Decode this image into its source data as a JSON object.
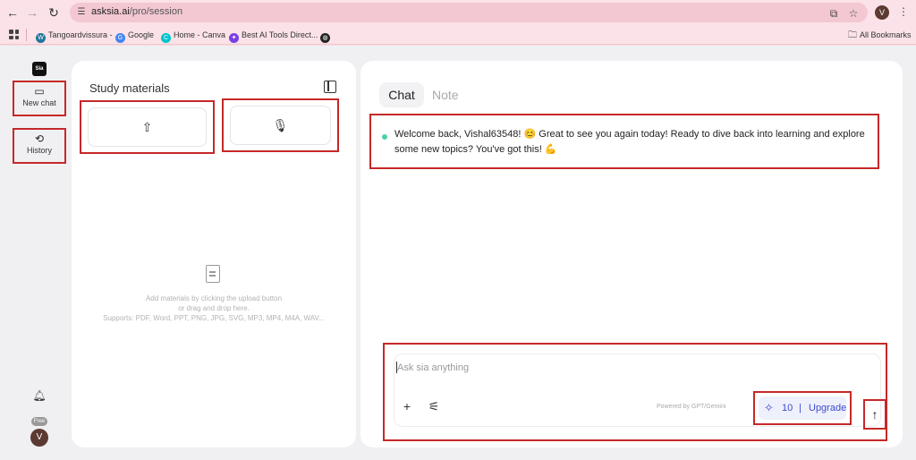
{
  "browser": {
    "url_host": "asksia.ai",
    "url_path": "/pro/session",
    "profile_initial": "V",
    "bookmarks": [
      {
        "label": "Tangoardvissura -",
        "icon": "wordpress-icon",
        "color": "#21759b"
      },
      {
        "label": "Google",
        "icon": "google-icon",
        "color": "#4285f4"
      },
      {
        "label": "Home - Canva",
        "icon": "canva-icon",
        "color": "#00c4cc"
      },
      {
        "label": "Best AI Tools Direct...",
        "icon": "ai-tools-icon",
        "color": "#7b3fe4"
      }
    ],
    "all_bookmarks_label": "All Bookmarks"
  },
  "sidebar": {
    "logo_text": "Sia",
    "new_chat_label": "New chat",
    "history_label": "History",
    "plan_badge": "Free",
    "avatar_initial": "V"
  },
  "materials": {
    "title": "Study materials",
    "empty_line1": "Add materials by clicking the upload button",
    "empty_line2": "or drag and drop here.",
    "empty_line3": "Supports: PDF, Word, PPT, PNG, JPG, SVG, MP3, MP4, M4A, WAV..."
  },
  "chat": {
    "tab_chat": "Chat",
    "tab_note": "Note",
    "welcome_message": "Welcome back, Vishal63548! 😊 Great to see you again today! Ready to dive back into learning and explore some new topics? You've got this! 💪",
    "input_placeholder": "Ask sia anything",
    "powered_by": "Powered by GPT/Gemini",
    "credits": "10",
    "separator": "|",
    "upgrade_label": "Upgrade"
  },
  "colors": {
    "highlight_border": "#c62828",
    "accent": "#3b4bd0",
    "status_dot": "#49d3a0"
  }
}
